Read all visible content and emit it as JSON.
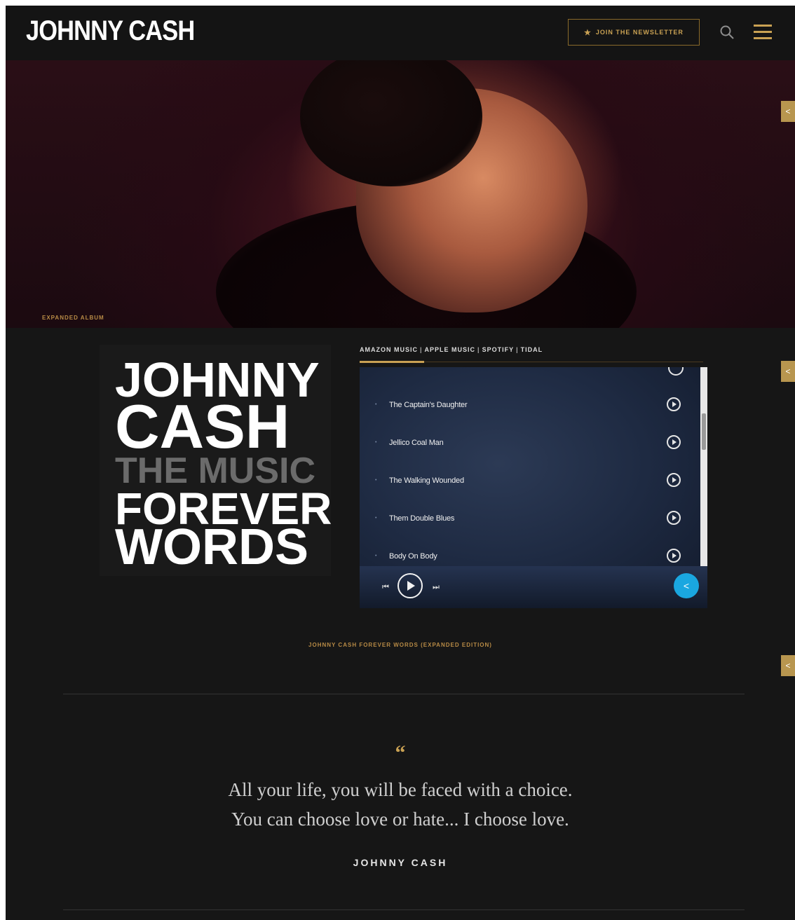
{
  "header": {
    "logo": "JOHNNY CASH",
    "newsletter_label": "JOIN THE NEWSLETTER"
  },
  "hero": {
    "label": "EXPANDED ALBUM"
  },
  "album": {
    "art_lines": [
      "JOHNNY",
      "CASH",
      "THE MUSIC",
      "FOREVER",
      "WORDS"
    ],
    "stream_tabs": [
      "AMAZON MUSIC",
      "APPLE MUSIC",
      "SPOTIFY",
      "TIDAL"
    ],
    "tracks": [
      {
        "title": "The Captain's Daughter"
      },
      {
        "title": "Jellico Coal Man"
      },
      {
        "title": "The Walking Wounded"
      },
      {
        "title": "Them Double Blues"
      },
      {
        "title": "Body On Body"
      }
    ],
    "caption": "JOHNNY CASH FOREVER WORDS (EXPANDED EDITION)"
  },
  "quote": {
    "mark": "“",
    "line1": "All your life, you will be faced with a choice.",
    "line2": "You can choose love or hate... I choose love.",
    "author": "JOHNNY CASH"
  },
  "colors": {
    "accent": "#c9a153",
    "background": "#161616",
    "share_blue": "#1aa7e0"
  },
  "icons": [
    "star-icon",
    "search-icon",
    "menu-icon",
    "share-icon",
    "play-icon",
    "previous-icon",
    "next-icon"
  ]
}
